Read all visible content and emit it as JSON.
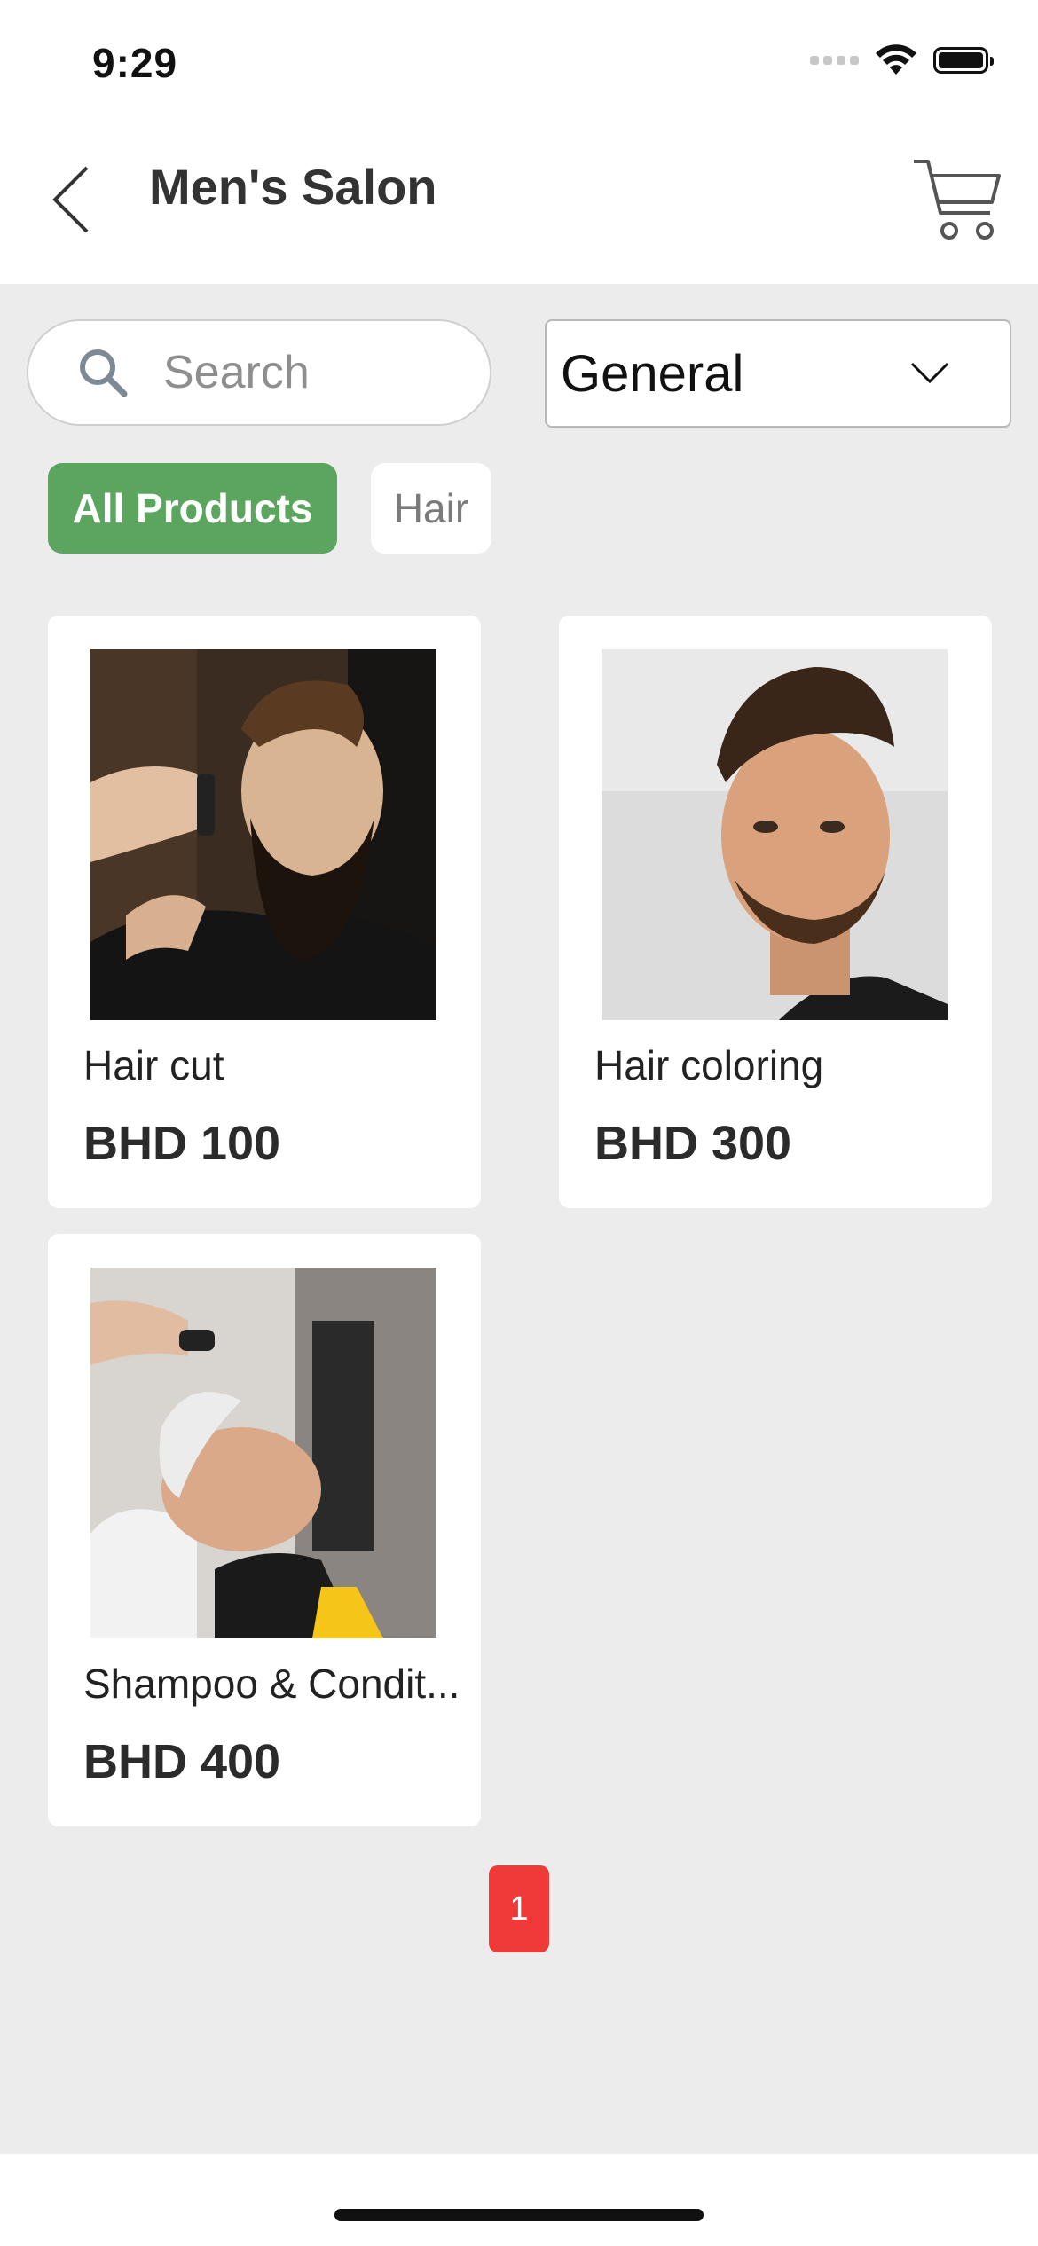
{
  "status_bar": {
    "time": "9:29",
    "icons": [
      "cellular-signal-icon",
      "wifi-icon",
      "battery-icon"
    ]
  },
  "header": {
    "title": "Men's Salon",
    "back_icon": "chevron-left-icon",
    "cart_icon": "shopping-cart-icon"
  },
  "search": {
    "placeholder": "Search",
    "value": ""
  },
  "category_select": {
    "selected": "General"
  },
  "filters": [
    {
      "label": "All Products",
      "active": true
    },
    {
      "label": "Hair",
      "active": false
    }
  ],
  "products": [
    {
      "name": "Hair cut",
      "price": "BHD 100",
      "image": "barber-trimming-beard-photo"
    },
    {
      "name": "Hair coloring",
      "price": "BHD 300",
      "image": "man-styled-hair-photo"
    },
    {
      "name": "Shampoo & Condit...",
      "price": "BHD 400",
      "image": "man-hair-wash-photo"
    }
  ],
  "pagination": {
    "current_page": "1"
  },
  "colors": {
    "active_chip": "#5ba55f",
    "page_button": "#f03a3a",
    "background": "#ececec"
  }
}
